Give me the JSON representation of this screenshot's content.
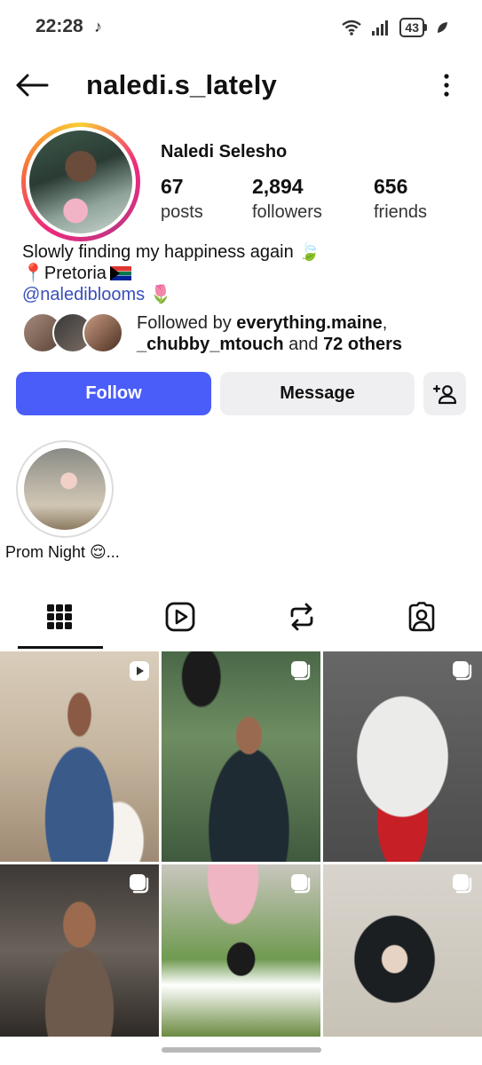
{
  "status_bar": {
    "time": "22:28",
    "battery": "43"
  },
  "header": {
    "username": "naledi.s_lately"
  },
  "profile": {
    "full_name": "Naledi Selesho",
    "stats": {
      "posts_value": "67",
      "posts_label": "posts",
      "followers_value": "2,894",
      "followers_label": "followers",
      "friends_value": "656",
      "friends_label": "friends"
    },
    "bio": {
      "line1": "Slowly finding my happiness again 🍃",
      "line2": "📍Pretoria",
      "handle": "@nalediblooms 🌷"
    },
    "followed_by": {
      "prefix": "Followed by ",
      "user1": "everything.maine",
      "sep": ",",
      "user2": "_chubby_mtouch",
      "and": " and ",
      "others": "72 others"
    }
  },
  "actions": {
    "follow_label": "Follow",
    "message_label": "Message"
  },
  "highlights": [
    {
      "label": "Prom Night 😌..."
    }
  ],
  "tabs": [
    "grid-icon",
    "reels-icon",
    "reposts-icon",
    "tagged-icon"
  ],
  "grid_posts": [
    {
      "type": "reel"
    },
    {
      "type": "carousel"
    },
    {
      "type": "carousel"
    },
    {
      "type": "carousel"
    },
    {
      "type": "carousel"
    },
    {
      "type": "carousel"
    }
  ],
  "colors": {
    "follow_button": "#4a5df9",
    "secondary_button": "#efeff1",
    "link": "#3a4fb8"
  }
}
